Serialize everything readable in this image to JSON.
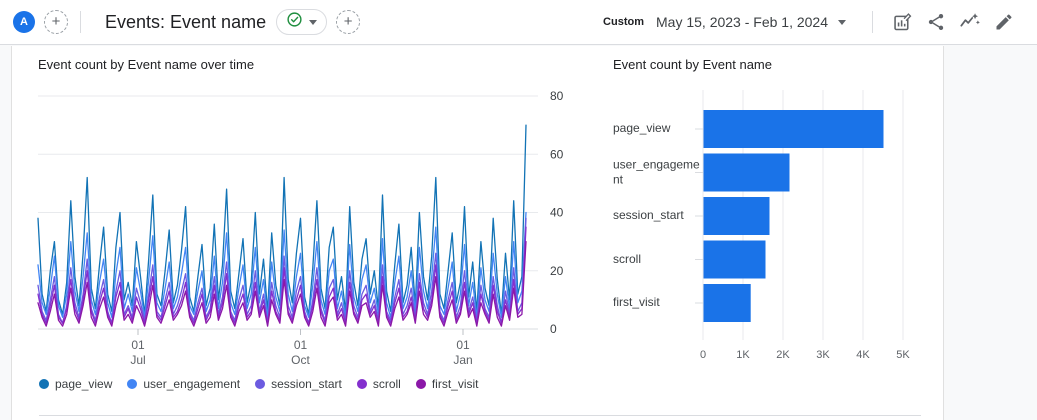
{
  "header": {
    "avatar_letter": "A",
    "add_tab_label": "+",
    "title": "Events: Event name",
    "add_card_label": "+",
    "date_mode_label": "Custom",
    "date_range": "May 15, 2023 - Feb 1, 2024",
    "toolbar_icons": [
      "customize-report",
      "share",
      "insights",
      "edit"
    ]
  },
  "colors": {
    "accent_blue": "#1A73E8",
    "badge_green": "#1E8E3E",
    "text_dark": "#202124",
    "text_gray": "#5F6368",
    "grid": "#E8EAED",
    "divider": "#DADCE0"
  },
  "chart_data": [
    {
      "type": "line",
      "title": "Event count by Event name over time",
      "ylim": [
        0,
        80
      ],
      "yticks": [
        0,
        20,
        40,
        60,
        80
      ],
      "grid": "horizontal",
      "legend_position": "bottom",
      "xticks": [
        {
          "pos": 0.2,
          "line1": "01",
          "line2": "Jul"
        },
        {
          "pos": 0.525,
          "line1": "01",
          "line2": "Oct"
        },
        {
          "pos": 0.85,
          "line1": "01",
          "line2": "Jan"
        }
      ],
      "series": [
        {
          "name": "page_view",
          "color": "#1273B5",
          "values": [
            38,
            12,
            6,
            20,
            30,
            10,
            5,
            16,
            44,
            18,
            8,
            26,
            52,
            14,
            7,
            22,
            35,
            12,
            6,
            28,
            40,
            10,
            16,
            8,
            30,
            18,
            5,
            24,
            46,
            12,
            8,
            20,
            34,
            9,
            15,
            27,
            42,
            11,
            6,
            18,
            29,
            8,
            14,
            36,
            10,
            22,
            48,
            13,
            7,
            19,
            31,
            9,
            16,
            40,
            12,
            24,
            6,
            33,
            15,
            8,
            52,
            17,
            9,
            26,
            38,
            11,
            5,
            21,
            44,
            14,
            7,
            28,
            35,
            10,
            18,
            6,
            42,
            16,
            8,
            24,
            31,
            12,
            20,
            7,
            46,
            13,
            6,
            22,
            36,
            9,
            15,
            28,
            8,
            40,
            18,
            10,
            25,
            52,
            12,
            7,
            20,
            33,
            9,
            16,
            42,
            11,
            23,
            6,
            30,
            14,
            8,
            38,
            17,
            5,
            26,
            10,
            44,
            12,
            18,
            70
          ]
        },
        {
          "name": "user_engagement",
          "color": "#4285F4",
          "values": [
            22,
            9,
            5,
            14,
            25,
            8,
            4,
            12,
            30,
            13,
            6,
            18,
            33,
            10,
            5,
            16,
            24,
            9,
            4,
            19,
            28,
            7,
            12,
            6,
            21,
            13,
            4,
            17,
            32,
            9,
            6,
            14,
            23,
            7,
            11,
            19,
            28,
            8,
            5,
            13,
            20,
            6,
            10,
            25,
            7,
            16,
            33,
            9,
            5,
            14,
            22,
            7,
            12,
            28,
            9,
            17,
            4,
            23,
            11,
            6,
            34,
            12,
            6,
            18,
            26,
            8,
            4,
            15,
            30,
            10,
            5,
            20,
            24,
            7,
            13,
            4,
            29,
            11,
            6,
            17,
            22,
            9,
            14,
            5,
            31,
            9,
            4,
            16,
            25,
            7,
            11,
            20,
            6,
            28,
            13,
            7,
            18,
            35,
            8,
            5,
            14,
            23,
            6,
            12,
            29,
            8,
            16,
            4,
            21,
            10,
            6,
            26,
            12,
            4,
            18,
            7,
            30,
            9,
            13,
            40
          ]
        },
        {
          "name": "session_start",
          "color": "#6C5BE0",
          "values": [
            15,
            6,
            3,
            10,
            18,
            5,
            2,
            8,
            21,
            9,
            4,
            12,
            24,
            7,
            3,
            11,
            17,
            6,
            2,
            13,
            20,
            5,
            8,
            4,
            14,
            9,
            3,
            12,
            22,
            6,
            4,
            10,
            16,
            5,
            8,
            13,
            19,
            6,
            3,
            9,
            14,
            4,
            7,
            18,
            5,
            11,
            23,
            6,
            3,
            10,
            15,
            5,
            8,
            20,
            6,
            12,
            2,
            16,
            8,
            4,
            25,
            8,
            4,
            13,
            18,
            6,
            2,
            10,
            21,
            7,
            3,
            14,
            17,
            5,
            9,
            3,
            20,
            8,
            4,
            12,
            15,
            6,
            10,
            3,
            22,
            6,
            3,
            11,
            17,
            5,
            8,
            14,
            4,
            19,
            9,
            5,
            13,
            26,
            6,
            3,
            10,
            16,
            4,
            8,
            20,
            6,
            11,
            3,
            15,
            7,
            4,
            18,
            8,
            2,
            13,
            5,
            21,
            6,
            9,
            38
          ]
        },
        {
          "name": "scroll",
          "color": "#8430CE",
          "values": [
            12,
            5,
            2,
            8,
            15,
            4,
            2,
            7,
            17,
            7,
            3,
            10,
            20,
            6,
            2,
            9,
            14,
            5,
            2,
            11,
            16,
            4,
            7,
            3,
            11,
            7,
            2,
            10,
            18,
            5,
            3,
            8,
            13,
            4,
            6,
            10,
            16,
            5,
            2,
            7,
            12,
            3,
            6,
            15,
            4,
            9,
            19,
            5,
            2,
            8,
            12,
            4,
            6,
            16,
            5,
            10,
            2,
            13,
            6,
            3,
            21,
            6,
            3,
            10,
            15,
            5,
            2,
            8,
            17,
            6,
            2,
            11,
            14,
            4,
            7,
            2,
            16,
            6,
            3,
            10,
            12,
            5,
            8,
            2,
            18,
            5,
            2,
            9,
            14,
            4,
            6,
            11,
            3,
            16,
            7,
            4,
            10,
            22,
            5,
            2,
            8,
            13,
            3,
            6,
            16,
            5,
            9,
            2,
            12,
            6,
            3,
            15,
            6,
            2,
            10,
            4,
            17,
            5,
            7,
            35
          ]
        },
        {
          "name": "first_visit",
          "color": "#8B18A8",
          "values": [
            9,
            4,
            1,
            6,
            12,
            3,
            1,
            5,
            14,
            5,
            2,
            8,
            16,
            4,
            1,
            7,
            11,
            4,
            1,
            8,
            13,
            3,
            5,
            2,
            8,
            5,
            1,
            7,
            15,
            4,
            2,
            6,
            10,
            3,
            5,
            8,
            13,
            4,
            1,
            5,
            9,
            2,
            4,
            12,
            3,
            7,
            15,
            4,
            1,
            6,
            9,
            3,
            5,
            13,
            4,
            8,
            1,
            10,
            5,
            2,
            17,
            5,
            2,
            8,
            12,
            4,
            1,
            6,
            14,
            4,
            1,
            9,
            11,
            3,
            5,
            1,
            13,
            5,
            2,
            8,
            9,
            4,
            6,
            1,
            15,
            4,
            1,
            7,
            11,
            3,
            5,
            9,
            2,
            13,
            5,
            3,
            8,
            18,
            4,
            1,
            6,
            10,
            2,
            5,
            13,
            4,
            7,
            1,
            9,
            5,
            2,
            12,
            4,
            1,
            8,
            3,
            14,
            4,
            5,
            30
          ]
        }
      ]
    },
    {
      "type": "bar",
      "orientation": "horizontal",
      "title": "Event count by Event name",
      "categories": [
        "page_view",
        "user_engagement",
        "session_start",
        "scroll",
        "first_visit"
      ],
      "values": [
        4500,
        2150,
        1650,
        1550,
        1180
      ],
      "bar_color": "#1A73E8",
      "xlim": [
        0,
        5000
      ],
      "xtick_labels": [
        "0",
        "1K",
        "2K",
        "3K",
        "4K",
        "5K"
      ],
      "grid": "vertical"
    }
  ]
}
